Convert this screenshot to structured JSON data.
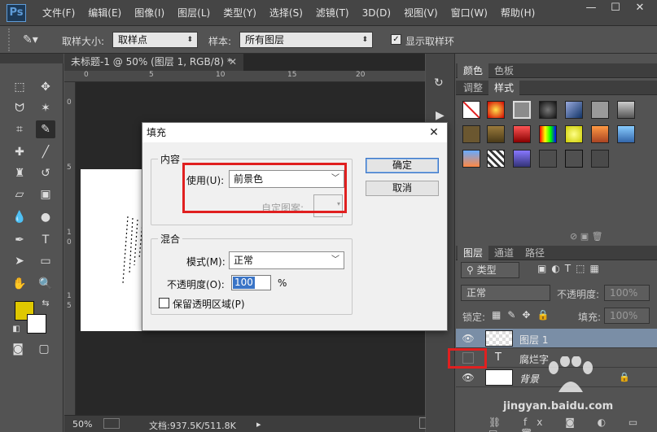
{
  "app": {
    "logo": "Ps"
  },
  "menu": [
    "文件(F)",
    "编辑(E)",
    "图像(I)",
    "图层(L)",
    "类型(Y)",
    "选择(S)",
    "滤镜(T)",
    "3D(D)",
    "视图(V)",
    "窗口(W)",
    "帮助(H)"
  ],
  "options_bar": {
    "sample_size_label": "取样大小:",
    "sample_size_value": "取样点",
    "sample_label": "样本:",
    "sample_value": "所有图层",
    "show_ring_label": "显示取样环",
    "show_ring_checked": true
  },
  "document": {
    "tab_title": "未标题-1 @ 50% (图层 1, RGB/8) *",
    "ruler_top_ticks": [
      "0",
      "5",
      "10",
      "15",
      "20"
    ],
    "ruler_left_ticks": [
      "0",
      "5",
      "1",
      "0",
      "1",
      "5"
    ],
    "zoom": "50%",
    "doc_info": "文档:937.5K/511.8K"
  },
  "panels": {
    "color_tabs": [
      "颜色",
      "色板"
    ],
    "style_tabs": [
      "调整",
      "样式"
    ],
    "layer_tabs": [
      "图层",
      "通道",
      "路径"
    ],
    "layer_filter": "类型",
    "blend_mode": "正常",
    "opacity_label": "不透明度:",
    "opacity_value": "100%",
    "lock_label": "锁定:",
    "fill_label": "填充:",
    "fill_value": "100%",
    "layers": [
      {
        "name": "图层 1",
        "visible": true,
        "selected": true
      },
      {
        "name": "腐烂字",
        "visible": false,
        "selected": false,
        "type_icon": "T"
      },
      {
        "name": "背景",
        "visible": true,
        "selected": false
      }
    ]
  },
  "dialog": {
    "title": "填充",
    "content_group": "内容",
    "use_label": "使用(U):",
    "use_value": "前景色",
    "custom_pattern_label": "自定图案:",
    "blend_group": "混合",
    "mode_label": "模式(M):",
    "mode_value": "正常",
    "opacity_label": "不透明度(O):",
    "opacity_value": "100",
    "opacity_unit": "%",
    "preserve_label": "保留透明区域(P)",
    "ok_label": "确定",
    "cancel_label": "取消"
  },
  "watermark": "jingyan.baidu.com",
  "colors": {
    "foreground": "#dfc800",
    "background": "#ffffff",
    "highlight_box": "#e02020",
    "selected_layer": "#7a8ea6"
  }
}
